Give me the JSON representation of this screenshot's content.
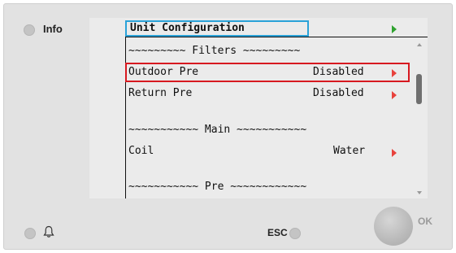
{
  "device": {
    "info_label": "Info",
    "esc_label": "ESC",
    "ok_label": "OK"
  },
  "screen": {
    "title": "Unit Configuration",
    "rows": [
      {
        "type": "section",
        "label": "~~~~~~~~~ Filters ~~~~~~~~~"
      },
      {
        "type": "item",
        "label": "Outdoor Pre",
        "value": "Disabled",
        "selected": true
      },
      {
        "type": "item",
        "label": "Return Pre",
        "value": "Disabled",
        "selected": false
      },
      {
        "type": "section",
        "label": "~~~~~~~~~~~ Main ~~~~~~~~~~~"
      },
      {
        "type": "item",
        "label": "Coil",
        "value": "Water",
        "selected": false
      },
      {
        "type": "section",
        "label": "~~~~~~~~~~~ Pre ~~~~~~~~~~~~"
      }
    ]
  },
  "icons": {
    "bell": "bell-icon",
    "title_arrow": "play-arrow-icon",
    "row_arrow": "play-arrow-icon"
  },
  "colors": {
    "title_frame": "#2aa2d8",
    "selection_frame": "#d71920",
    "row_arrow": "#e8423c",
    "title_arrow": "#2fa22f"
  }
}
